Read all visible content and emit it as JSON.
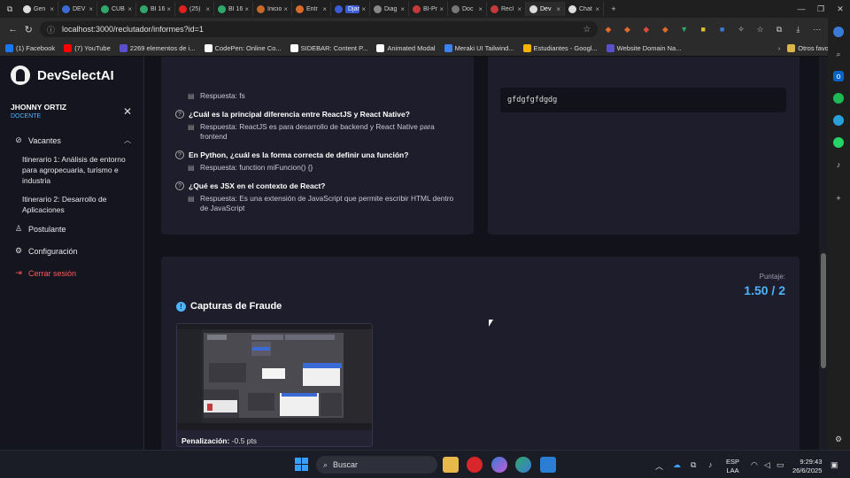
{
  "browser": {
    "tabs": [
      {
        "label": "Gen",
        "color": "#ddd"
      },
      {
        "label": "DEV",
        "color": "#3b6bd6"
      },
      {
        "label": "CUB",
        "color": "#2fa86b"
      },
      {
        "label": "BI 16",
        "color": "#2fa86b"
      },
      {
        "label": "(25)",
        "color": "#e02020"
      },
      {
        "label": "BI 16",
        "color": "#2fa86b"
      },
      {
        "label": "Inicio",
        "color": "#c46a2a"
      },
      {
        "label": "Entr",
        "color": "#d86a2a"
      },
      {
        "label": "Django",
        "color": "#3b5bd6",
        "active": true
      },
      {
        "label": "Diag",
        "color": "#888"
      },
      {
        "label": "BI-Pr",
        "color": "#c43a3a"
      },
      {
        "label": "Doc",
        "color": "#777"
      },
      {
        "label": "Recl",
        "color": "#c43a3a"
      },
      {
        "label": "Dev",
        "color": "#ddd",
        "current": true
      },
      {
        "label": "Chat",
        "color": "#ddd"
      }
    ],
    "tab_close": "×",
    "new_tab": "+",
    "url": "localhost:3000/reclutador/informes?id=1",
    "bookmarks": [
      {
        "label": "(1) Facebook",
        "color": "#1877f2"
      },
      {
        "label": "(7) YouTube",
        "color": "#ff0000"
      },
      {
        "label": "2269 elementos de i...",
        "color": "#5a4fcf"
      },
      {
        "label": "CodePen: Online Co...",
        "color": "#ffffff"
      },
      {
        "label": "SIDEBAR: Content P...",
        "color": "#ffffff"
      },
      {
        "label": "Animated Modal",
        "color": "#ffffff"
      },
      {
        "label": "Meraki UI Tailwind...",
        "color": "#3b82f6"
      },
      {
        "label": "Estudiantes - Googl...",
        "color": "#f4b400"
      },
      {
        "label": "Website Domain Na...",
        "color": "#5a4fcf"
      }
    ],
    "other_bookmarks": "Otros favoritos"
  },
  "sidebar": {
    "brand": "DevSelectAI",
    "user_name": "JHONNY ORTIZ",
    "user_role": "DOCENTE",
    "close_symbol": "✕",
    "vacantes_label": "Vacantes",
    "sub_items": [
      "Itinerario 1: Análisis de entorno para agropecuaria, turismo e industria",
      "Itinerario 2: Desarrollo de Aplicaciones"
    ],
    "postulante_label": "Postulante",
    "configuracion_label": "Configuración",
    "logout_label": "Cerrar sesión"
  },
  "questions": {
    "first_answer": "Respuesta: fs",
    "items": [
      {
        "q": "¿Cuál es la principal diferencia entre ReactJS y React Native?",
        "a": "Respuesta: ReactJS es para desarrollo de backend y React Native para frontend"
      },
      {
        "q": "En Python, ¿cuál es la forma correcta de definir una función?",
        "a": "Respuesta: function miFuncion() {}"
      },
      {
        "q": "¿Qué es JSX en el contexto de React?",
        "a": "Respuesta: Es una extensión de JavaScript que permite escribir HTML dentro de JavaScript"
      }
    ]
  },
  "code_answer": "gfdgfgfdgdg",
  "fraud": {
    "score_label": "Puntaje:",
    "score_value": "1.50 / 2",
    "title": "Capturas de Fraude",
    "penalty_label": "Penalización:",
    "penalty_value": "-0.5 pts"
  },
  "taskbar": {
    "search_label": "Buscar",
    "lang_top": "ESP",
    "lang_bottom": "LAA",
    "time": "9:29:43",
    "date": "26/6/2025"
  }
}
